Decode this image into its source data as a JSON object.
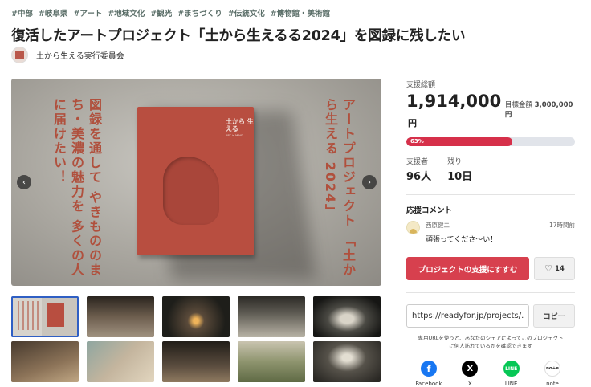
{
  "tags": [
    "#中部",
    "#岐阜県",
    "#アート",
    "#地域文化",
    "#観光",
    "#まちづくり",
    "#伝統文化",
    "#博物館・美術館"
  ],
  "title": "復活したアートプロジェクト「土から生えるる2024」を図録に残したい",
  "owner": {
    "name": "土から生える実行委員会"
  },
  "hero": {
    "left_text": "図録を通して やきもののまち・美濃の魅力を 多くの人に届けたい！",
    "right_text": "アートプロジェクト 「土から生える 2024」",
    "book_title": "土から 生える",
    "book_sub": "ART in MINO",
    "prev": "‹",
    "next": "›"
  },
  "funding": {
    "total_label": "支援総額",
    "amount": "1,914,000",
    "currency": "円",
    "goal_label": "目標金額",
    "goal_value": "3,000,000円",
    "progress_percent": 63,
    "progress_text": "63%"
  },
  "stats": {
    "supporters_label": "支援者",
    "supporters_value": "96人",
    "remaining_label": "残り",
    "remaining_value": "10日"
  },
  "comments": {
    "heading": "応援コメント",
    "items": [
      {
        "user": "西原健二",
        "time": "17時間前",
        "text": "頑張ってくださ〜い！"
      }
    ]
  },
  "actions": {
    "support_label": "プロジェクトの支援にすすむ",
    "like_count": "14"
  },
  "share": {
    "url": "https://readyfor.jp/projects/...",
    "copy_label": "コピー",
    "note": "専用URLを使うと、あなたのシェアによってこのプロジェクトに何人訪れているかを確認できます",
    "items": [
      {
        "label": "Facebook",
        "glyph": "f"
      },
      {
        "label": "X",
        "glyph": "X"
      },
      {
        "label": "LINE",
        "glyph": "LINE"
      },
      {
        "label": "note",
        "glyph": "no+e"
      }
    ]
  },
  "colors": {
    "accent": "#d7404e",
    "progress": "#d6304a",
    "book": "#b84e40",
    "tag": "#5a6e68"
  }
}
